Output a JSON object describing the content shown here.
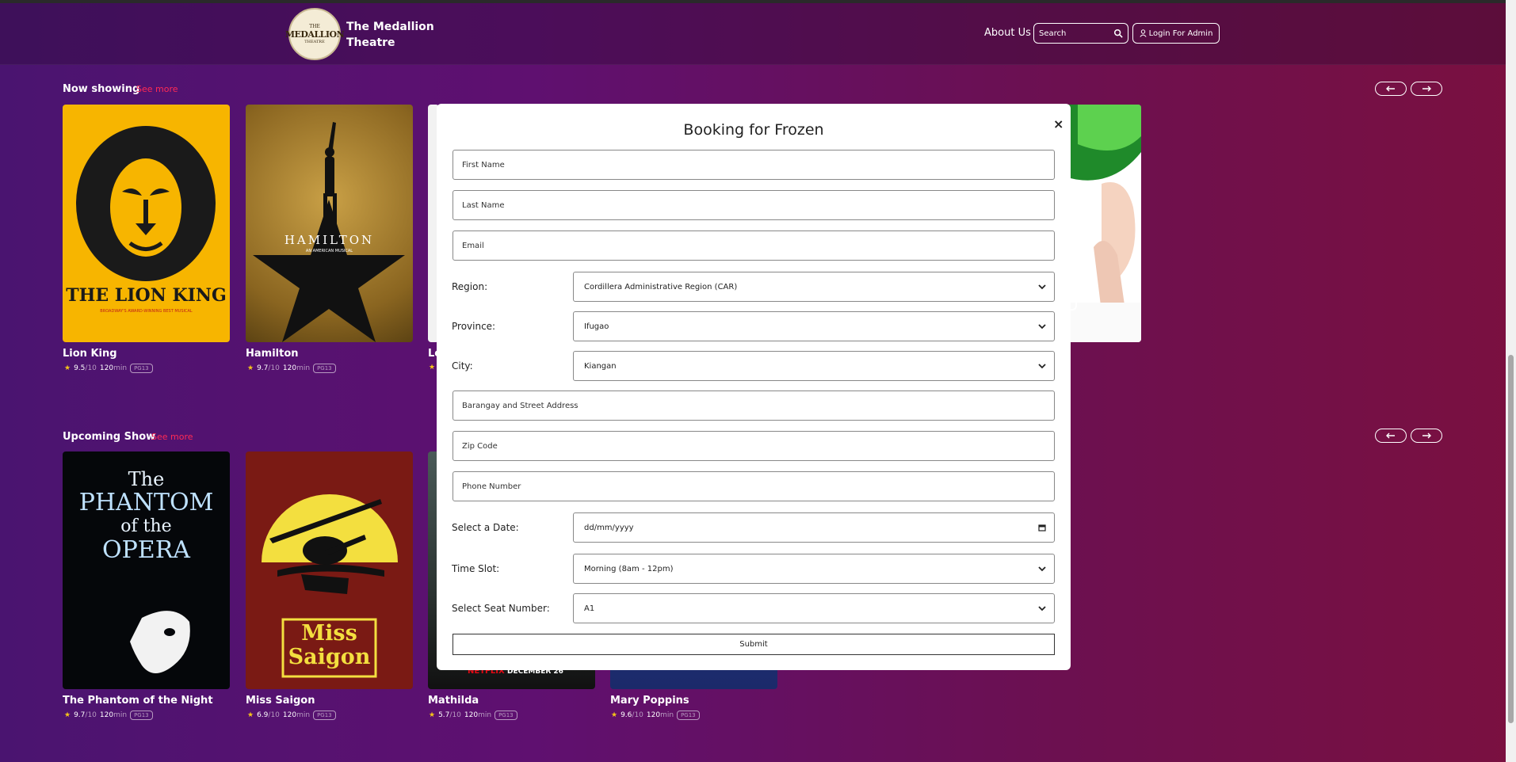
{
  "header": {
    "logo_lines": [
      "THE",
      "MEDALLION",
      "THEATRE"
    ],
    "brand": "The Medallion Theatre",
    "about": "About Us",
    "search_placeholder": "Search",
    "login": "Login For Admin"
  },
  "now_showing": {
    "title": "Now showing",
    "see_more": "See more",
    "cards": [
      {
        "title": "Lion King",
        "rating": "9.5",
        "max": "/10",
        "duration": "120",
        "unit": "min",
        "pg": "PG13",
        "poster_text": "THE LION KING",
        "poster_sub": "BROADWAY'S AWARD-WINNING BEST MUSICAL"
      },
      {
        "title": "Hamilton",
        "rating": "9.7",
        "max": "/10",
        "duration": "120",
        "unit": "min",
        "pg": "PG13",
        "poster_text": "HAMILTON",
        "poster_sub": "AN AMERICAN MUSICAL"
      },
      {
        "title": "Le",
        "rating": "",
        "max": "",
        "duration": "",
        "unit": "",
        "pg": ""
      }
    ]
  },
  "upcoming": {
    "title": "Upcoming Show",
    "see_more": "See more",
    "cards": [
      {
        "title": "The Phantom of the Night",
        "rating": "9.7",
        "max": "/10",
        "duration": "120",
        "unit": "min",
        "pg": "PG13",
        "poster_lines": [
          "The",
          "PHANTOM",
          "of the",
          "OPERA"
        ]
      },
      {
        "title": "Miss Saigon",
        "rating": "6.9",
        "max": "/10",
        "duration": "120",
        "unit": "min",
        "pg": "PG13",
        "poster_lines": [
          "Miss",
          "Saigon"
        ]
      },
      {
        "title": "Mathilda",
        "rating": "5.7",
        "max": "/10",
        "duration": "120",
        "unit": "min",
        "pg": "PG13",
        "poster_lines": [
          "NETFLIX",
          "DECEMBER 26"
        ]
      },
      {
        "title": "Mary Poppins",
        "rating": "9.6",
        "max": "/10",
        "duration": "120",
        "unit": "min",
        "pg": "PG13"
      }
    ]
  },
  "modal": {
    "title": "Booking for Frozen",
    "close": "×",
    "first_name": "First Name",
    "last_name": "Last Name",
    "email": "Email",
    "region_label": "Region:",
    "region_value": "Cordillera Administrative Region (CAR)",
    "province_label": "Province:",
    "province_value": "Ifugao",
    "city_label": "City:",
    "city_value": "Kiangan",
    "street": "Barangay and Street Address",
    "zip": "Zip Code",
    "phone": "Phone Number",
    "date_label": "Select a Date:",
    "date_value": "dd/mm/yyyy",
    "time_label": "Time Slot:",
    "time_value": "Morning (8am - 12pm)",
    "seat_label": "Select Seat Number:",
    "seat_value": "A1",
    "submit": "Submit"
  },
  "colors": {
    "accent": "#ff2a55",
    "star": "#f5c518"
  }
}
